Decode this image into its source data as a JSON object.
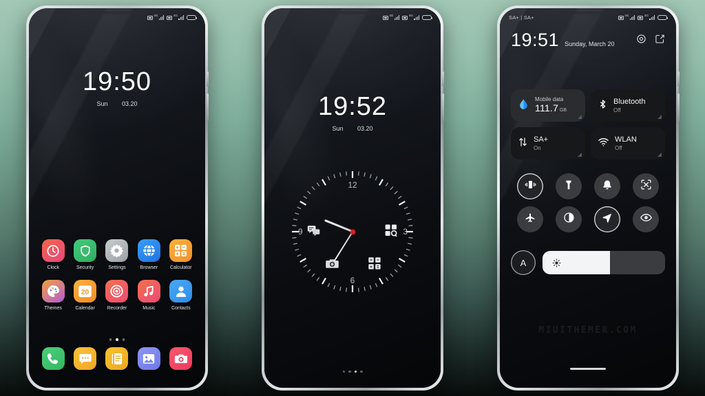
{
  "background": {
    "top_color": "#a3c8b5",
    "mid_color": "#6b9585",
    "bottom_color": "#080c0b"
  },
  "phone1": {
    "name": "home-screen",
    "statusbar": {
      "carrier": "",
      "sim1_network": "4G",
      "sim2_network": "4G"
    },
    "clock_widget": {
      "time": "19:50",
      "weekday": "Sun",
      "date": "03.20"
    },
    "apps": [
      {
        "label": "Clock",
        "icon": "clock-icon",
        "color1": "#f0674a",
        "color2": "#e8467e"
      },
      {
        "label": "Security",
        "icon": "shield-icon",
        "color1": "#43c97a",
        "color2": "#2fae61"
      },
      {
        "label": "Settings",
        "icon": "gear-icon",
        "color1": "#c8cccf",
        "color2": "#9aa0a4"
      },
      {
        "label": "Browser",
        "icon": "globe-icon",
        "color1": "#3a9dfa",
        "color2": "#1f74e0"
      },
      {
        "label": "Calculator",
        "icon": "calculator-icon",
        "color1": "#fbb03b",
        "color2": "#f2912a"
      },
      {
        "label": "Themes",
        "icon": "palette-icon",
        "color1": "#f2a03c",
        "color2": "#b35bd8"
      },
      {
        "label": "Calendar",
        "icon": "calendar-icon",
        "color1": "#fbb03b",
        "color2": "#ef8d27"
      },
      {
        "label": "Recorder",
        "icon": "recorder-icon",
        "color1": "#f2714e",
        "color2": "#ef4a74"
      },
      {
        "label": "Music",
        "icon": "music-icon",
        "color1": "#f2714e",
        "color2": "#ef4a74"
      },
      {
        "label": "Contacts",
        "icon": "contacts-icon",
        "color1": "#4aa8f5",
        "color2": "#2f8de8"
      }
    ],
    "calendar_day": "20",
    "page_dots": {
      "count": 3,
      "active_index": 1
    },
    "dock": [
      {
        "label": "Phone",
        "icon": "phone-icon",
        "color1": "#4bd07a",
        "color2": "#33b762"
      },
      {
        "label": "Messages",
        "icon": "message-icon",
        "color1": "#fcc13a",
        "color2": "#f0a726"
      },
      {
        "label": "Notes",
        "icon": "notes-icon",
        "color1": "#f9c22e",
        "color2": "#eda91f"
      },
      {
        "label": "Gallery",
        "icon": "gallery-icon",
        "color1": "#8e96f3",
        "color2": "#6f79e8"
      },
      {
        "label": "Camera",
        "icon": "camera-icon",
        "color1": "#f8576f",
        "color2": "#ef3a5c"
      }
    ]
  },
  "phone2": {
    "name": "analog-clock-screen",
    "clock_widget": {
      "time": "19:52",
      "weekday": "Sun",
      "date": "03.20"
    },
    "analog_clock": {
      "numerals": [
        "12",
        "3",
        "6",
        "9"
      ],
      "hour_angle_deg": -68,
      "minute_angle_deg": -148,
      "center_dot_color": "#e01f2a"
    },
    "shortcuts": [
      {
        "name": "messages-shortcut",
        "icon": "message-icon"
      },
      {
        "name": "app-search-shortcut",
        "icon": "apps-search-icon"
      },
      {
        "name": "camera-shortcut",
        "icon": "camera-icon"
      },
      {
        "name": "calculator-shortcut",
        "icon": "calculator-icon"
      }
    ],
    "page_dots": {
      "count": 4,
      "active_index": 2
    }
  },
  "phone3": {
    "name": "control-center",
    "statusbar": {
      "carrier": "SA+ | SA+",
      "sim1_network": "4G",
      "sim2_network": "4G"
    },
    "header": {
      "time": "19:51",
      "date": "Sunday, March 20",
      "settings_icon": "gear-icon",
      "edit_icon": "edit-icon"
    },
    "tiles": [
      {
        "name": "mobile-data-tile",
        "icon": "data-droplet-icon",
        "label": "Mobile data",
        "value": "111.7",
        "unit": "GB",
        "active": true
      },
      {
        "name": "bluetooth-tile",
        "icon": "bluetooth-icon",
        "label": "Bluetooth",
        "state": "Off",
        "active": false
      },
      {
        "name": "sa-plus-tile",
        "icon": "data-transfer-icon",
        "label": "SA+",
        "state": "On",
        "active": false
      },
      {
        "name": "wlan-tile",
        "icon": "wifi-icon",
        "label": "WLAN",
        "state": "Off",
        "active": false
      }
    ],
    "circle_toggles": [
      {
        "name": "vibrate-toggle",
        "icon": "vibrate-icon",
        "active": true
      },
      {
        "name": "flashlight-toggle",
        "icon": "flashlight-icon",
        "active": false
      },
      {
        "name": "sound-toggle",
        "icon": "bell-icon",
        "active": false
      },
      {
        "name": "screenshot-toggle",
        "icon": "screenshot-icon",
        "active": false
      },
      {
        "name": "airplane-toggle",
        "icon": "airplane-icon",
        "active": false
      },
      {
        "name": "dark-mode-toggle",
        "icon": "contrast-icon",
        "active": false
      },
      {
        "name": "location-toggle",
        "icon": "location-icon",
        "active": true
      },
      {
        "name": "reading-mode-toggle",
        "icon": "eye-icon",
        "active": false
      }
    ],
    "brightness": {
      "auto_label": "A",
      "icon": "sun-icon",
      "percent": 55
    },
    "watermark": "MIUITHEMER.COM"
  }
}
